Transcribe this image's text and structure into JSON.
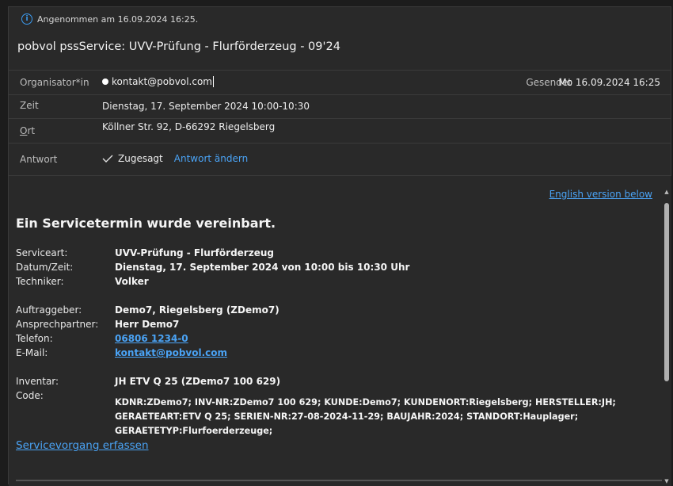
{
  "notice": {
    "text": "Angenommen am 16.09.2024 16:25."
  },
  "subject": "pobvol pssService: UVV-Prüfung - Flurförderzeug - 09'24",
  "meta": {
    "organizer_label": "Organisator*in",
    "organizer_value": "kontakt@pobvol.com",
    "sent_label": "Gesendet",
    "sent_value": "Mo 16.09.2024 16:25",
    "time_label": "Zeit",
    "time_value": "Dienstag, 17. September 2024 10:00-10:30",
    "location_label_first": "O",
    "location_label_rest": "rt",
    "location_value": "Köllner Str. 92, D-66292 Riegelsberg",
    "response_label": "Antwort",
    "response_value": "Zugesagt",
    "change_response": "Antwort ändern"
  },
  "body": {
    "english_link": "English version below",
    "heading": "Ein Servicetermin wurde vereinbart.",
    "fields": {
      "serviceart_label": "Serviceart:",
      "serviceart_value": "UVV-Prüfung - Flurförderzeug",
      "datetime_label": "Datum/Zeit:",
      "datetime_value": "Dienstag, 17. September 2024 von 10:00 bis 10:30 Uhr",
      "technician_label": "Techniker:",
      "technician_value": "Volker",
      "client_label": "Auftraggeber:",
      "client_value": "Demo7, Riegelsberg (ZDemo7)",
      "contact_label": "Ansprechpartner:",
      "contact_value": "Herr Demo7",
      "phone_label": "Telefon:",
      "phone_value": "06806 1234-0",
      "email_label": "E-Mail:",
      "email_value": "kontakt@pobvol.com",
      "inventory_label": "Inventar:",
      "inventory_value": "JH ETV Q 25 (ZDemo7 100 629)",
      "code_label": "Code:",
      "code_value": "KDNR:ZDemo7; INV-NR:ZDemo7 100 629; KUNDE:Demo7; KUNDENORT:Riegelsberg; HERSTELLER:JH; GERAETEART:ETV Q 25; SERIEN-NR:27-08-2024-11-29; BAUJAHR:2024; STANDORT:Hauplager; GERAETETYP:Flurfoerderzeuge;"
    },
    "service_link": "Servicevorgang erfassen"
  },
  "colors": {
    "accent": "#4aa3f5",
    "background": "#292929",
    "info_icon": "#3b9cf2"
  }
}
